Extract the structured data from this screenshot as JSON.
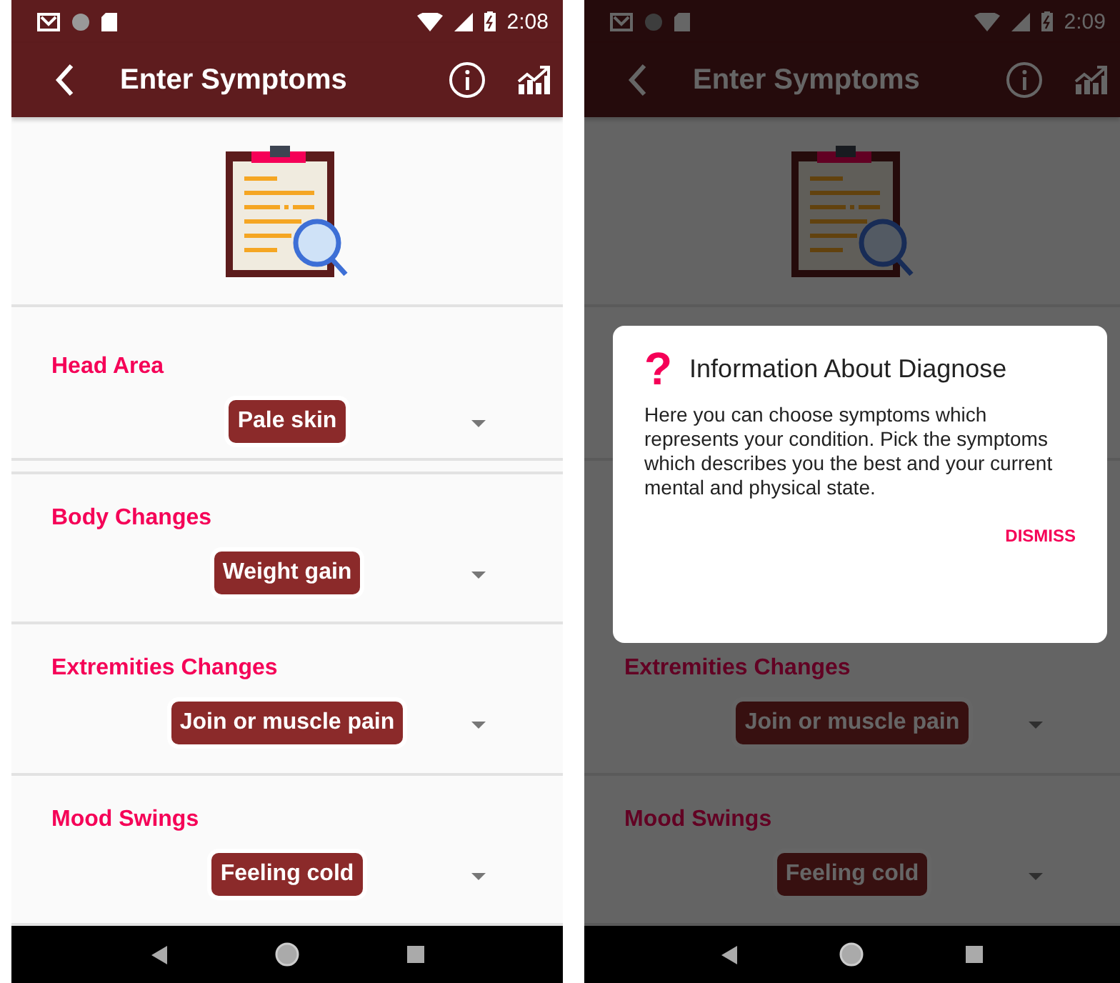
{
  "screens": [
    {
      "status_time": "2:08",
      "title": "Enter Symptoms",
      "categories": [
        {
          "label": "Head Area",
          "value": "Pale skin"
        },
        {
          "label": "Body Changes",
          "value": "Weight gain"
        },
        {
          "label": "Extremities Changes",
          "value": "Join or muscle pain"
        },
        {
          "label": "Mood Swings",
          "value": "Feeling cold"
        }
      ]
    },
    {
      "status_time": "2:09",
      "title": "Enter Symptoms",
      "categories": [
        {
          "label": "Extremities Changes",
          "value": "Join or muscle pain"
        },
        {
          "label": "Mood Swings",
          "value": "Feeling cold"
        }
      ],
      "dialog": {
        "icon": "?",
        "title": "Information About Diagnose",
        "message": "Here you can choose symptoms which represents your condition. Pick the symptoms which describes you the best and your current mental and physical state.",
        "button": "DISMISS"
      }
    }
  ]
}
